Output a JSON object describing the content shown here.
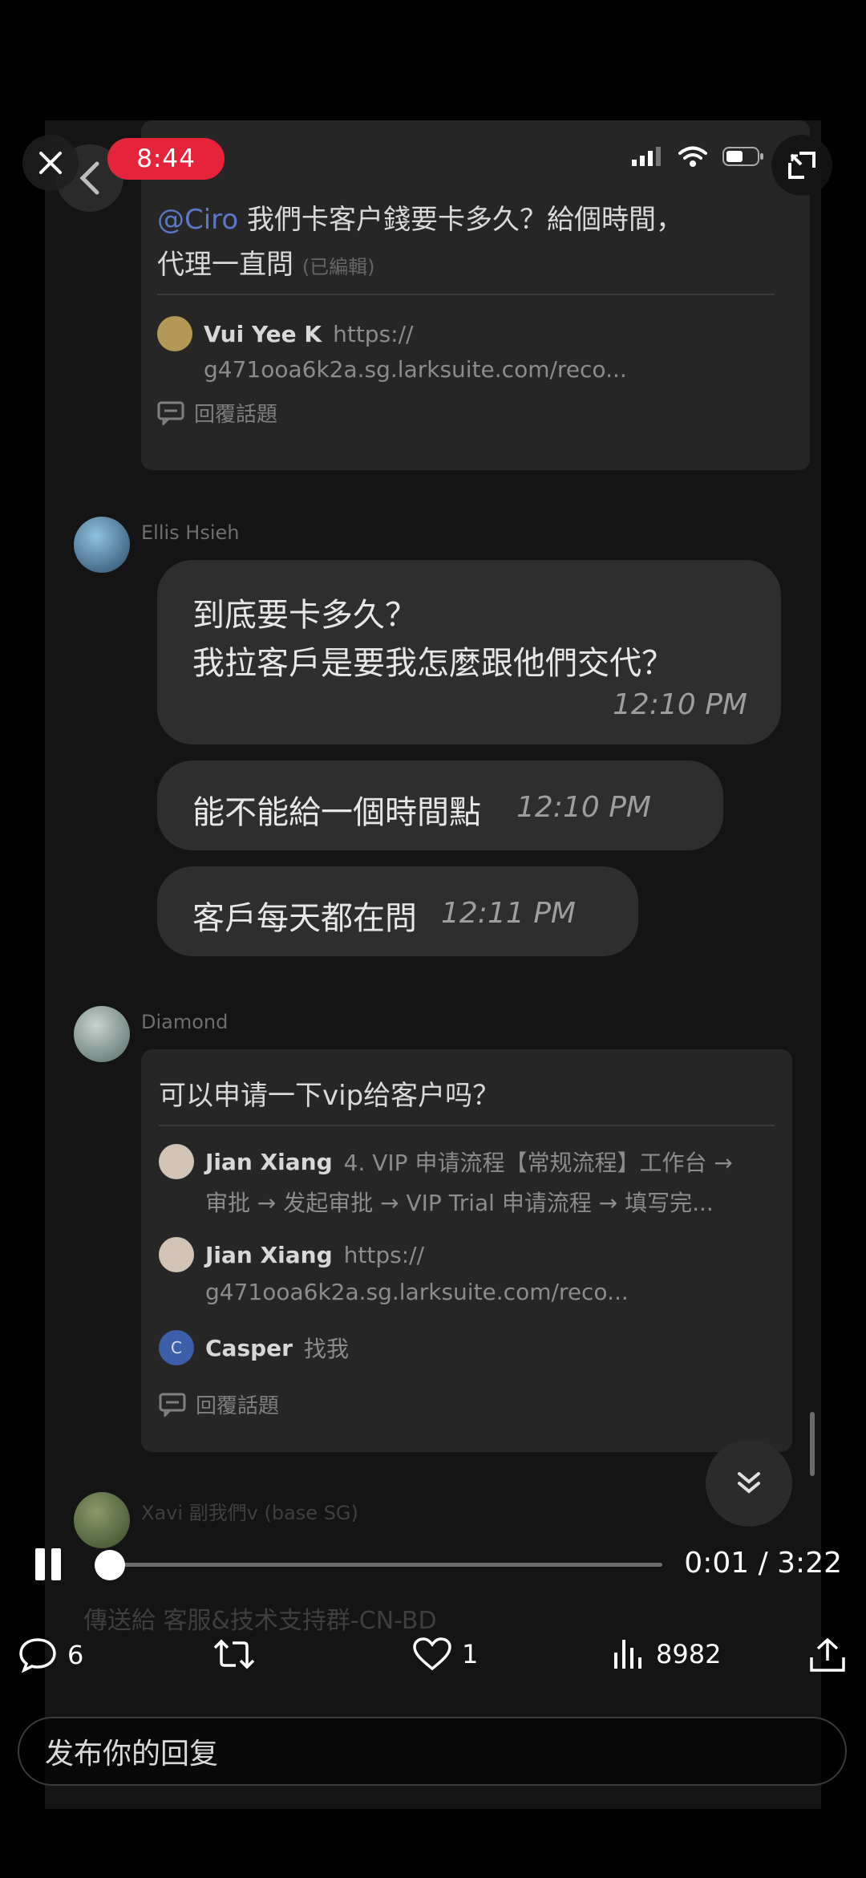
{
  "status": {
    "time": "8:44"
  },
  "chat": {
    "card1": {
      "mention": "@Ciro",
      "text_line1": "我們卡客户錢要卡多久？給個時間，",
      "text_line2": "代理一直問",
      "edited": "(已編輯)",
      "reply_name": "Vui Yee K",
      "reply_link_prefix": "https://",
      "reply_link": "g471ooa6k2a.sg.larksuite.com/reco...",
      "thread_label": "回覆話題"
    },
    "ellis": {
      "name": "Ellis Hsieh",
      "msg1_line1": "到底要卡多久？",
      "msg1_line2": "我拉客戶是要我怎麼跟他們交代？",
      "msg1_time": "12:10 PM",
      "msg2": "能不能給一個時間點",
      "msg2_time": "12:10 PM",
      "msg3": "客戶每天都在問",
      "msg3_time": "12:11 PM"
    },
    "diamond": {
      "name": "Diamond",
      "text": "可以申请一下vip给客户吗？",
      "r1_name": "Jian Xiang",
      "r1_text_line1": "4. VIP 申请流程【常规流程】工作台 →",
      "r1_text_line2": "审批 → 发起审批 → VIP Trial 申请流程 → 填写完...",
      "r2_name": "Jian Xiang",
      "r2_link_prefix": "https://",
      "r2_link": "g471ooa6k2a.sg.larksuite.com/reco...",
      "r3_avatar": "C",
      "r3_name": "Casper",
      "r3_text": "找我",
      "thread_label": "回覆話題"
    },
    "partial_next": "Xavi   副我們v (base SG)",
    "composer_hint": "傳送給 客服&技术支持群-CN-BD"
  },
  "player": {
    "elapsed": "0:01",
    "duration": "3:22",
    "progress": 0.005
  },
  "actions": {
    "comments": "6",
    "reposts": "",
    "likes": "1",
    "views": "8982"
  },
  "reply_placeholder": "发布你的回复"
}
